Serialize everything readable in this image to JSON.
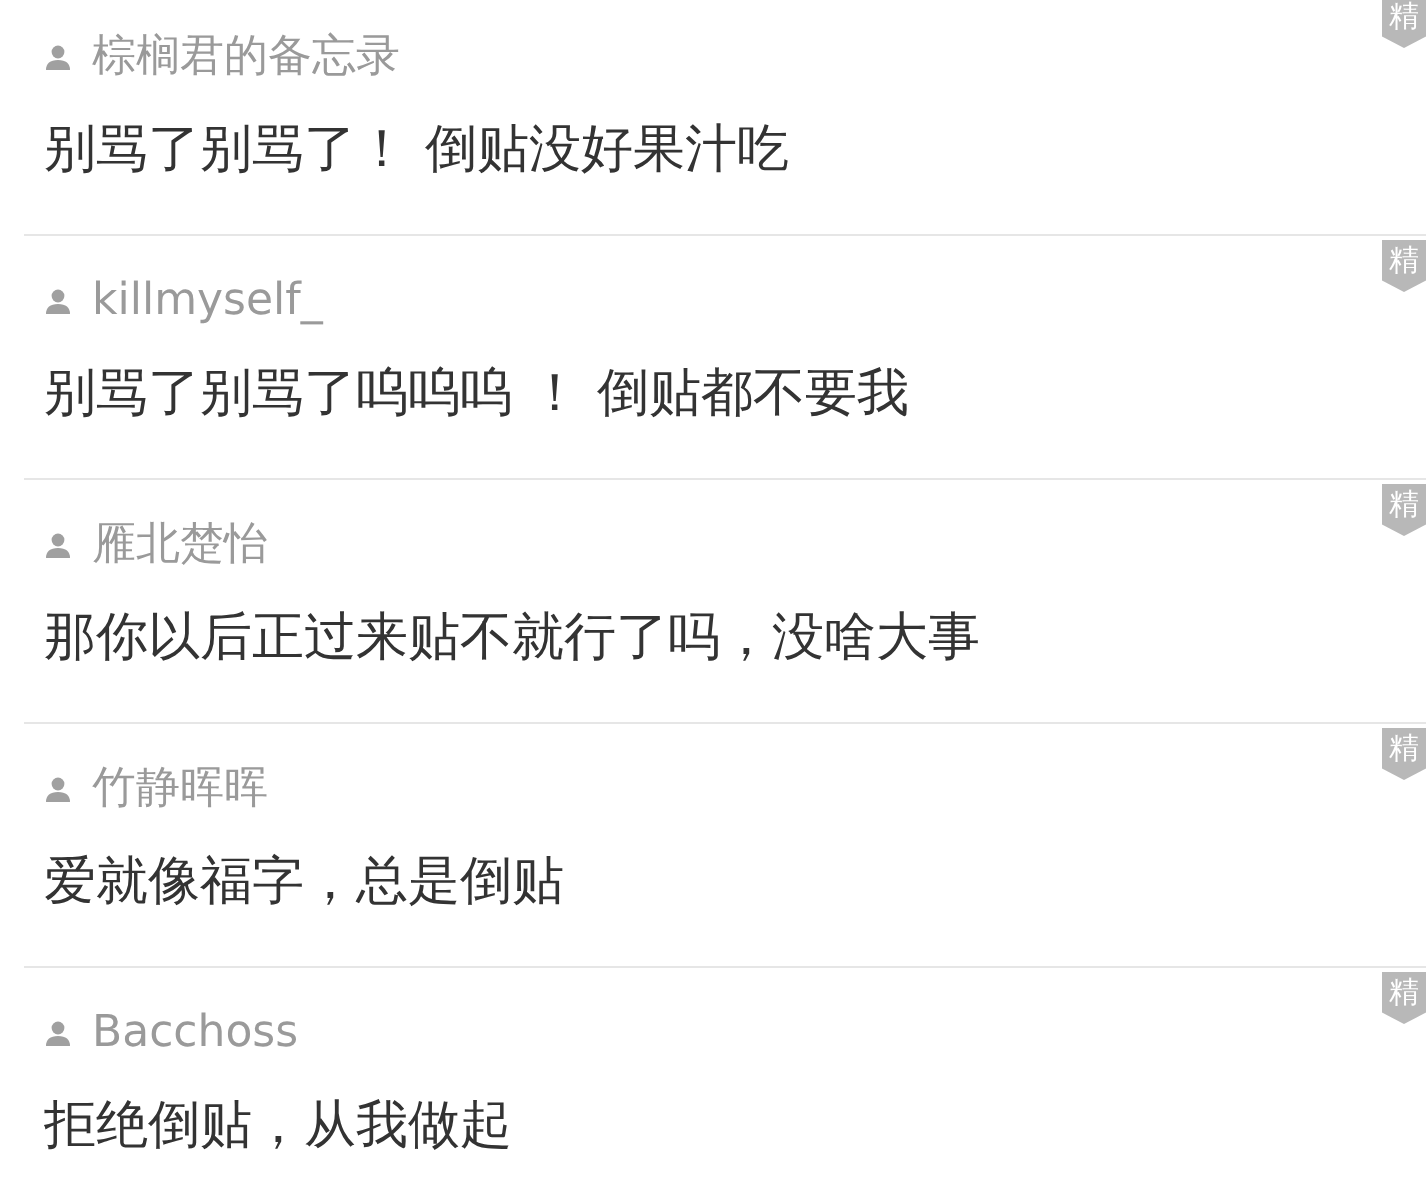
{
  "comments": [
    {
      "user": "棕榈君的备忘录",
      "text": "别骂了别骂了！ 倒贴没好果汁吃",
      "badge": "精"
    },
    {
      "user": "killmyself_",
      "text": "别骂了别骂了呜呜呜 ！ 倒贴都不要我",
      "badge": "精"
    },
    {
      "user": "雁北楚怡",
      "text": "那你以后正过来贴不就行了吗，没啥大事",
      "badge": "精"
    },
    {
      "user": "竹静晖晖",
      "text": "爱就像福字，总是倒贴",
      "badge": "精"
    },
    {
      "user": "Bacchoss",
      "text": "拒绝倒贴，从我做起",
      "badge": "精"
    }
  ]
}
